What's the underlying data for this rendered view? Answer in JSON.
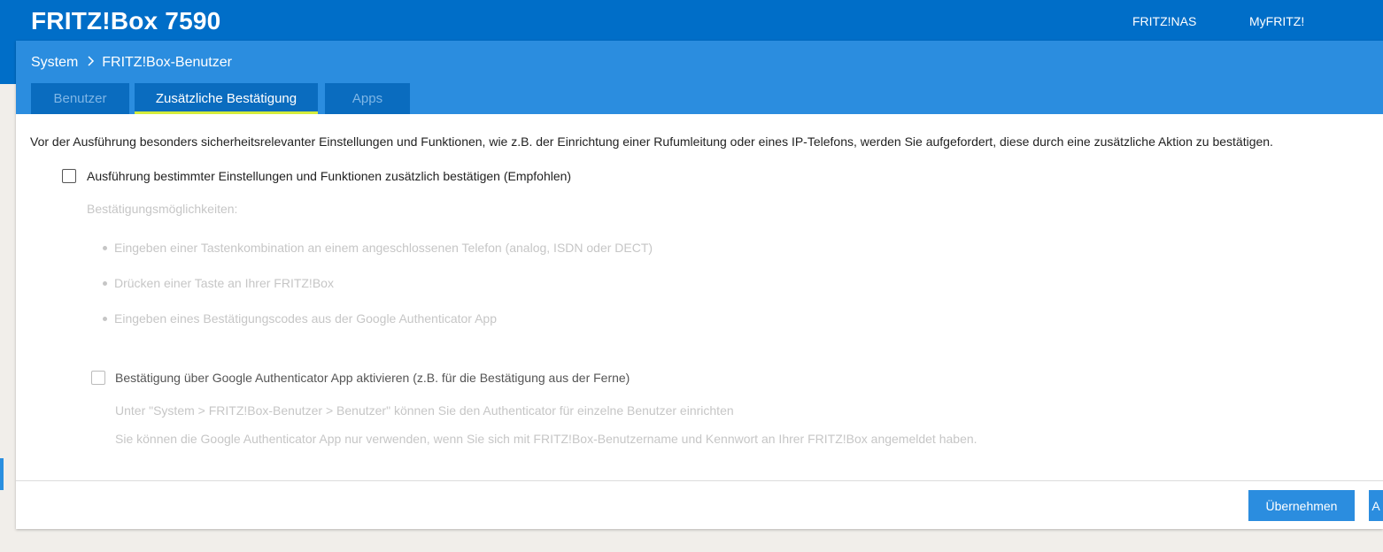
{
  "header": {
    "brand": "FRITZ!Box 7590",
    "links": [
      "FRITZ!NAS",
      "MyFRITZ!"
    ]
  },
  "breadcrumb": {
    "section": "System",
    "page": "FRITZ!Box-Benutzer"
  },
  "tabs": [
    {
      "label": "Benutzer",
      "active": false
    },
    {
      "label": "Zusätzliche Bestätigung",
      "active": true
    },
    {
      "label": "Apps",
      "active": false
    }
  ],
  "content": {
    "intro": "Vor der Ausführung besonders sicherheitsrelevanter Einstellungen und Funktionen, wie z.B. der Einrichtung einer Rufumleitung oder eines IP-Telefons, werden Sie aufgefordert, diese durch eine zusätzliche Aktion zu bestätigen.",
    "main_checkbox_label": "Ausführung bestimmter Einstellungen und Funktionen zusätzlich bestätigen (Empfohlen)",
    "main_checkbox_checked": false,
    "options_heading": "Bestätigungsmöglichkeiten:",
    "options": [
      "Eingeben einer Tastenkombination an einem angeschlossenen Telefon (analog, ISDN oder DECT)",
      "Drücken einer Taste an Ihrer FRITZ!Box",
      "Eingeben eines Bestätigungscodes aus der Google Authenticator App"
    ],
    "authenticator_checkbox_label": "Bestätigung über Google Authenticator App aktivieren (z.B. für die Bestätigung aus der Ferne)",
    "authenticator_checkbox_checked": false,
    "note1": "Unter \"System > FRITZ!Box-Benutzer > Benutzer\" können Sie den Authenticator für einzelne Benutzer einrichten",
    "note2": "Sie können die Google Authenticator App nur verwenden, wenn Sie sich mit FRITZ!Box-Benutzername und Kennwort an Ihrer FRITZ!Box angemeldet haben."
  },
  "footer": {
    "apply_label": "Übernehmen",
    "next_label": "A"
  },
  "colors": {
    "topbar": "#006ec8",
    "panel_header": "#2b8ddf",
    "tab_bg": "#0a6cbf",
    "tab_active_underline": "#d4ec3c",
    "button": "#2b8ddf"
  }
}
